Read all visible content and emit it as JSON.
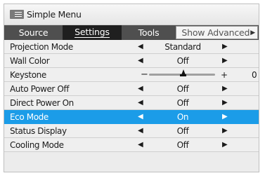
{
  "header": {
    "title": "Simple Menu",
    "icon": "menu-icon"
  },
  "tabs": [
    {
      "label": "Source",
      "active": false
    },
    {
      "label": "Settings",
      "active": true
    },
    {
      "label": "Tools",
      "active": false
    }
  ],
  "show_advanced": {
    "label": "Show Advanced",
    "icon": "triangle-right-icon"
  },
  "rows": [
    {
      "label": "Projection Mode",
      "value": "Standard"
    },
    {
      "label": "Wall Color",
      "value": "Off"
    },
    {
      "label": "Keystone",
      "type": "slider",
      "value": "0",
      "level": 0.5
    },
    {
      "label": "Auto Power Off",
      "value": "Off"
    },
    {
      "label": "Direct Power On",
      "value": "Off"
    },
    {
      "label": "Eco Mode",
      "value": "On",
      "selected": true
    },
    {
      "label": "Status Display",
      "value": "Off"
    },
    {
      "label": "Cooling Mode",
      "value": "Off"
    }
  ],
  "colors": {
    "selected_row": "#1b9ce8",
    "tab_bar": "#4f4f4f",
    "active_tab": "#1f1f1f"
  }
}
